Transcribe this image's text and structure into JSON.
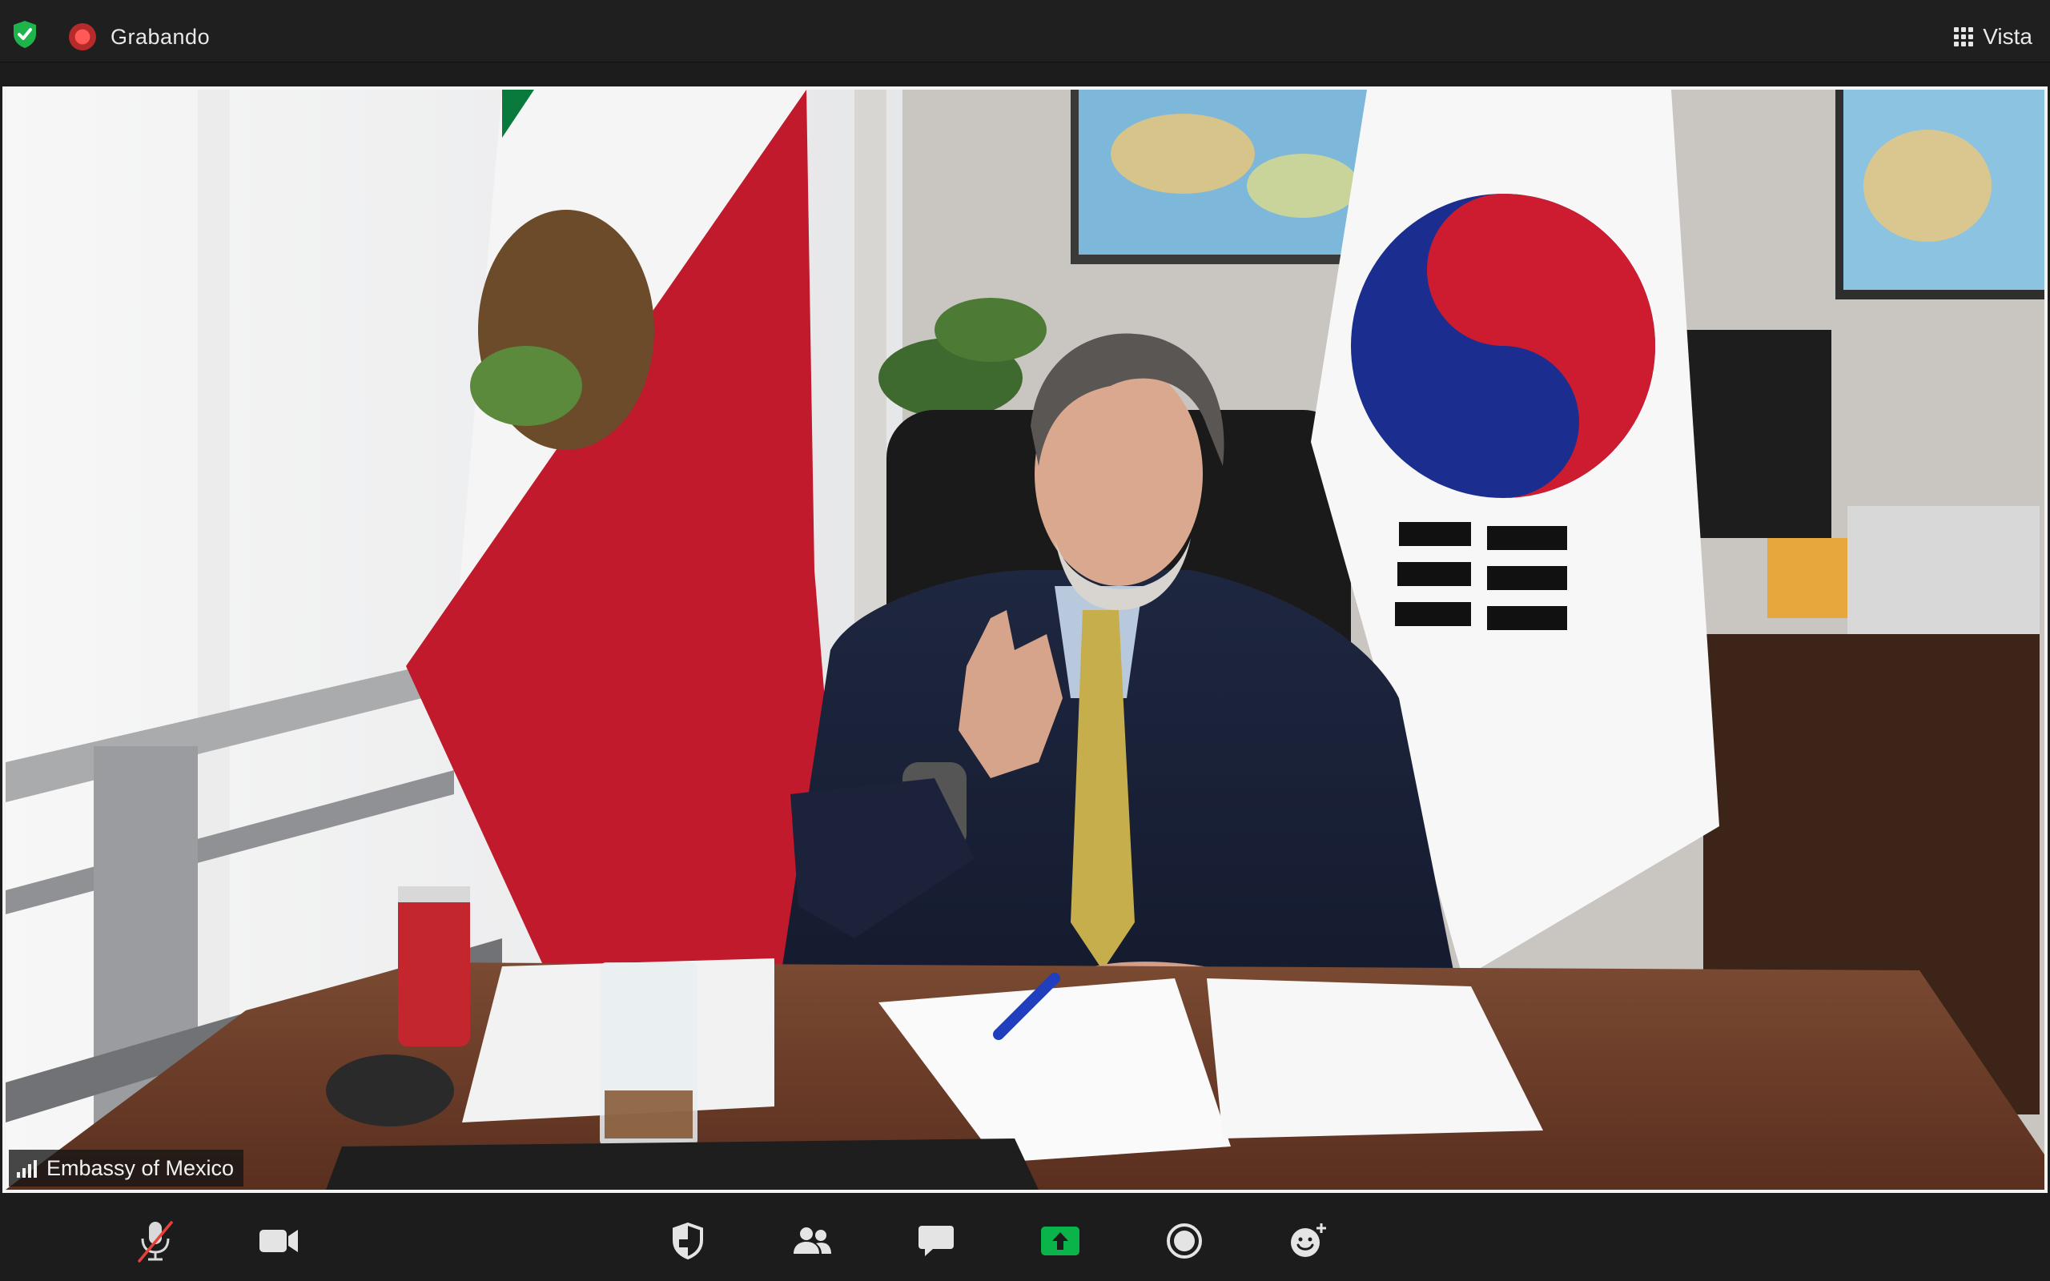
{
  "topbar": {
    "recording_label": "Grabando",
    "view_label": "Vista",
    "security_icon": "shield-check-icon",
    "recording_icon": "record-dot-icon",
    "view_icon": "grid-icon"
  },
  "video": {
    "participant_name": "Embassy of Mexico",
    "signal_icon": "signal-bars-icon"
  },
  "toolbar": {
    "items": [
      {
        "name": "unmute",
        "icon": "microphone-muted-icon"
      },
      {
        "name": "video",
        "icon": "video-camera-icon"
      },
      {
        "name": "security",
        "icon": "shield-icon"
      },
      {
        "name": "participants",
        "icon": "participants-icon"
      },
      {
        "name": "chat",
        "icon": "chat-bubble-icon"
      },
      {
        "name": "share-screen",
        "icon": "share-screen-icon"
      },
      {
        "name": "record",
        "icon": "record-icon"
      },
      {
        "name": "reactions",
        "icon": "emoji-add-icon"
      }
    ]
  },
  "colors": {
    "accent_green": "#0bb44a",
    "record_red": "#e8413c",
    "mexico_red": "#c01a2c",
    "mexico_green": "#0a7a3c",
    "korea_red": "#cd1b30",
    "korea_blue": "#1b2e8f"
  }
}
